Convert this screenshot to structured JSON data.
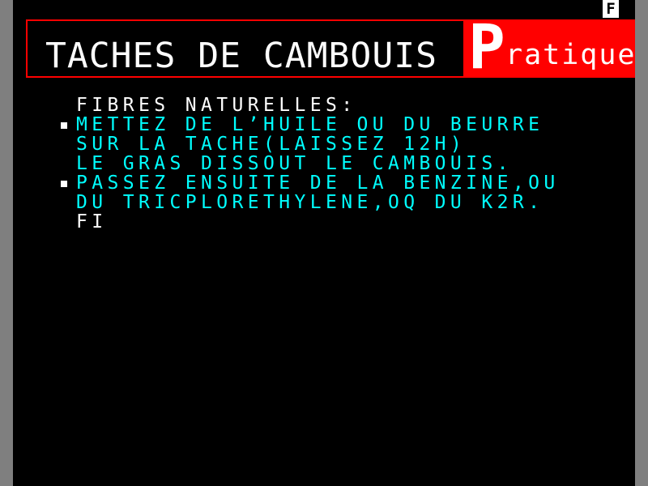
{
  "status": {
    "indicator": "F"
  },
  "header": {
    "title": "TACHES DE CAMBOUIS",
    "brand_initial": "P",
    "brand_rest": "ratique"
  },
  "content": {
    "lines": [
      "FIBRES NATURELLES:",
      "METTEZ DE L’HUILE OU DU BEURRE",
      "SUR LA TACHE(LAISSEZ 12H)",
      "LE GRAS DISSOUT LE CAMBOUIS.",
      "PASSEZ ENSUITE DE LA BENZINE,OU",
      "DU TRICPLORETHYLENE,OQ DU K2R.",
      "FI"
    ]
  },
  "colors": {
    "background": "#000000",
    "border": "#7f7f7f",
    "accent": "#ff0000",
    "text_primary": "#ffffff",
    "text_secondary": "#00ffff"
  }
}
